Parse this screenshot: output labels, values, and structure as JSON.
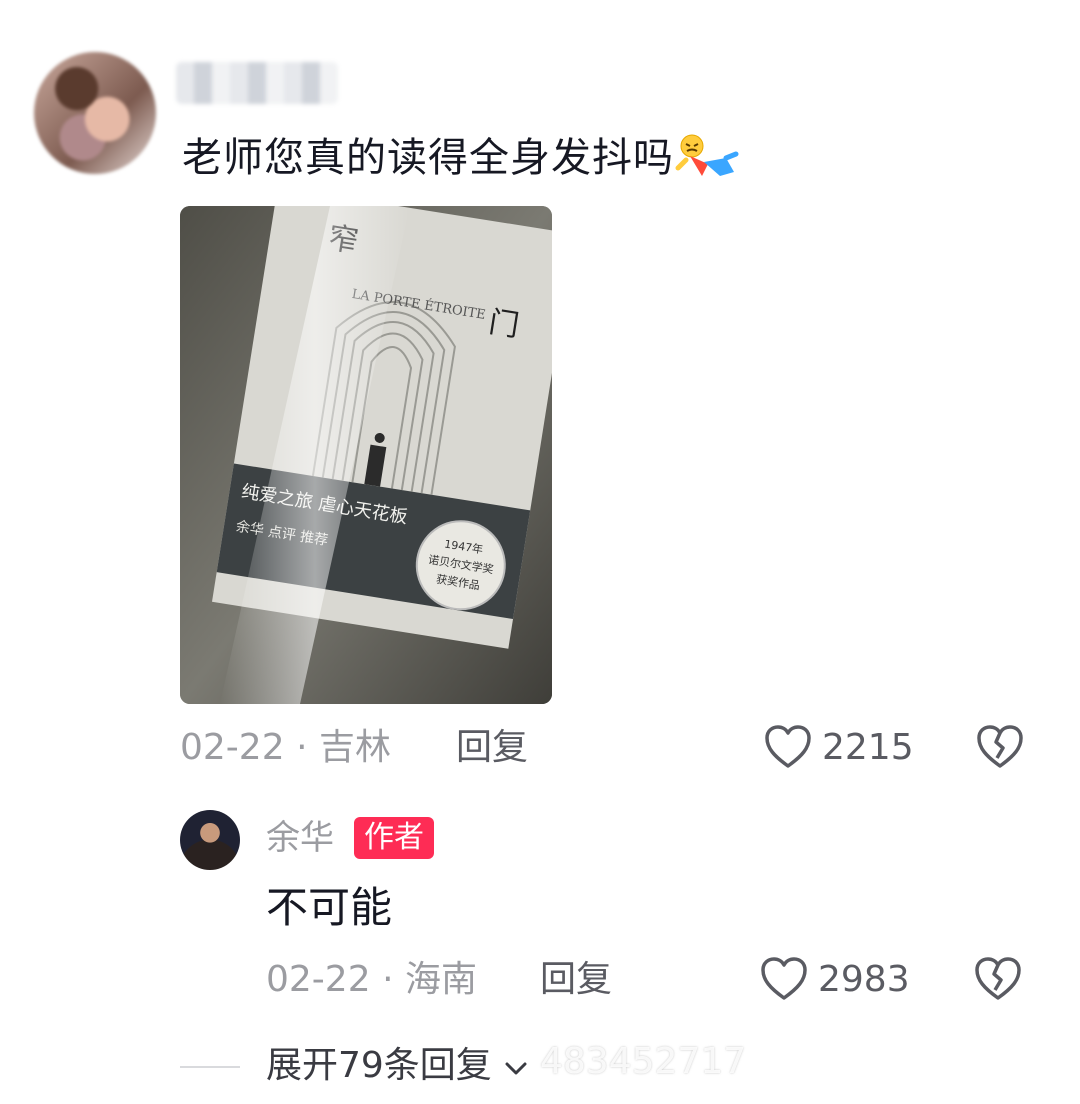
{
  "comment": {
    "text": "老师您真的读得全身发抖吗",
    "date": "02-22",
    "separator": "·",
    "location": "吉林",
    "reply_label": "回复",
    "like_count": "2215",
    "icons": {
      "like": "heart-outline-icon",
      "dislike": "broken-heart-icon",
      "emoji": "trembling-figure-emoji"
    }
  },
  "photo": {
    "book_title": [
      "窄",
      "门"
    ],
    "cover_text": "LA PORTE ÉTROITE",
    "band_lines": [
      "纯爱之旅 虐心天花板",
      "余华 点评 推荐"
    ],
    "seal_text": [
      "1947年",
      "诺贝尔文学奖",
      "获奖作品"
    ]
  },
  "reply": {
    "author": "余华",
    "badge": "作者",
    "text": "不可能",
    "date": "02-22",
    "separator": "·",
    "location": "海南",
    "reply_label": "回复",
    "like_count": "2983"
  },
  "expand": {
    "label": "展开79条回复",
    "icon": "chevron-down-icon"
  },
  "watermark": "483452717"
}
